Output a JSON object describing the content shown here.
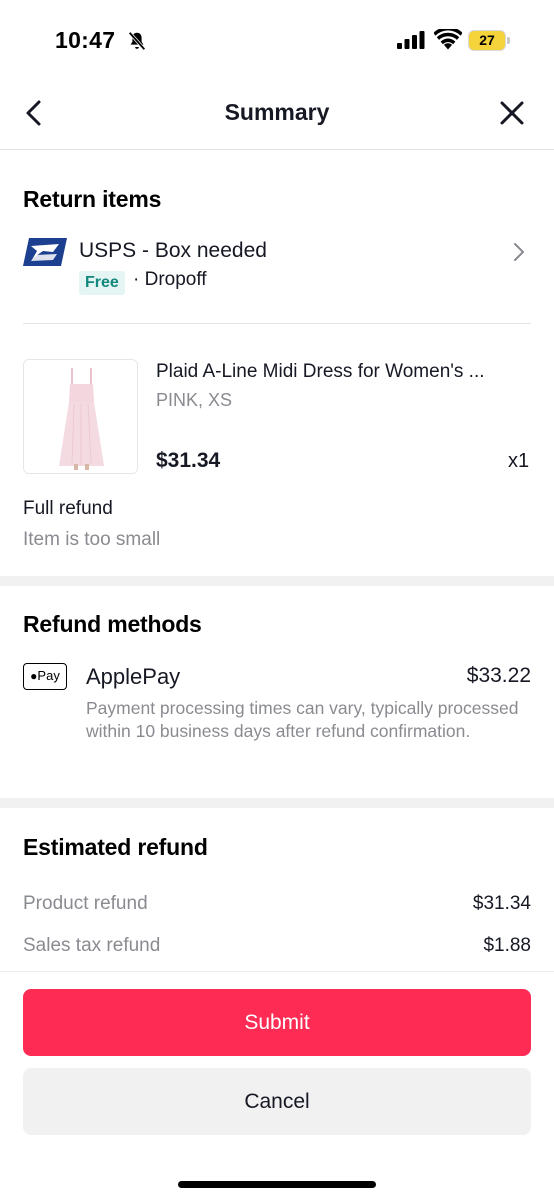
{
  "status_bar": {
    "time": "10:47",
    "battery": "27",
    "colors": {
      "battery_fill": "#f5d33a"
    }
  },
  "nav": {
    "title": "Summary",
    "back_icon": "chevron-left-icon",
    "close_icon": "close-icon"
  },
  "return_items": {
    "title": "Return items",
    "shipping": {
      "carrier": "USPS - Box needed",
      "badge": "Free",
      "method": "· Dropoff",
      "logo": "usps-eagle-logo"
    },
    "product": {
      "title": "Plaid A-Line Midi Dress for Women's ...",
      "variant": "PINK, XS",
      "price": "$31.34",
      "quantity": "x1"
    },
    "refund_type": "Full refund",
    "reason": "Item is too small"
  },
  "refund_methods": {
    "title": "Refund methods",
    "method": {
      "logo_text": "Pay",
      "name": "ApplePay",
      "amount": "$33.22",
      "note": "Payment processing times can vary, typically processed within 10 business days after refund confirmation."
    }
  },
  "estimated_refund": {
    "title": "Estimated refund",
    "rows": [
      {
        "label": "Product refund",
        "value": "$31.34"
      },
      {
        "label": "Sales tax refund",
        "value": "$1.88"
      }
    ]
  },
  "footer": {
    "submit_label": "Submit",
    "cancel_label": "Cancel"
  },
  "colors": {
    "primary": "#fe2c55",
    "free_badge_bg": "#e4f5f4",
    "free_badge_text": "#12877c",
    "secondary_text": "#8a8b91"
  }
}
